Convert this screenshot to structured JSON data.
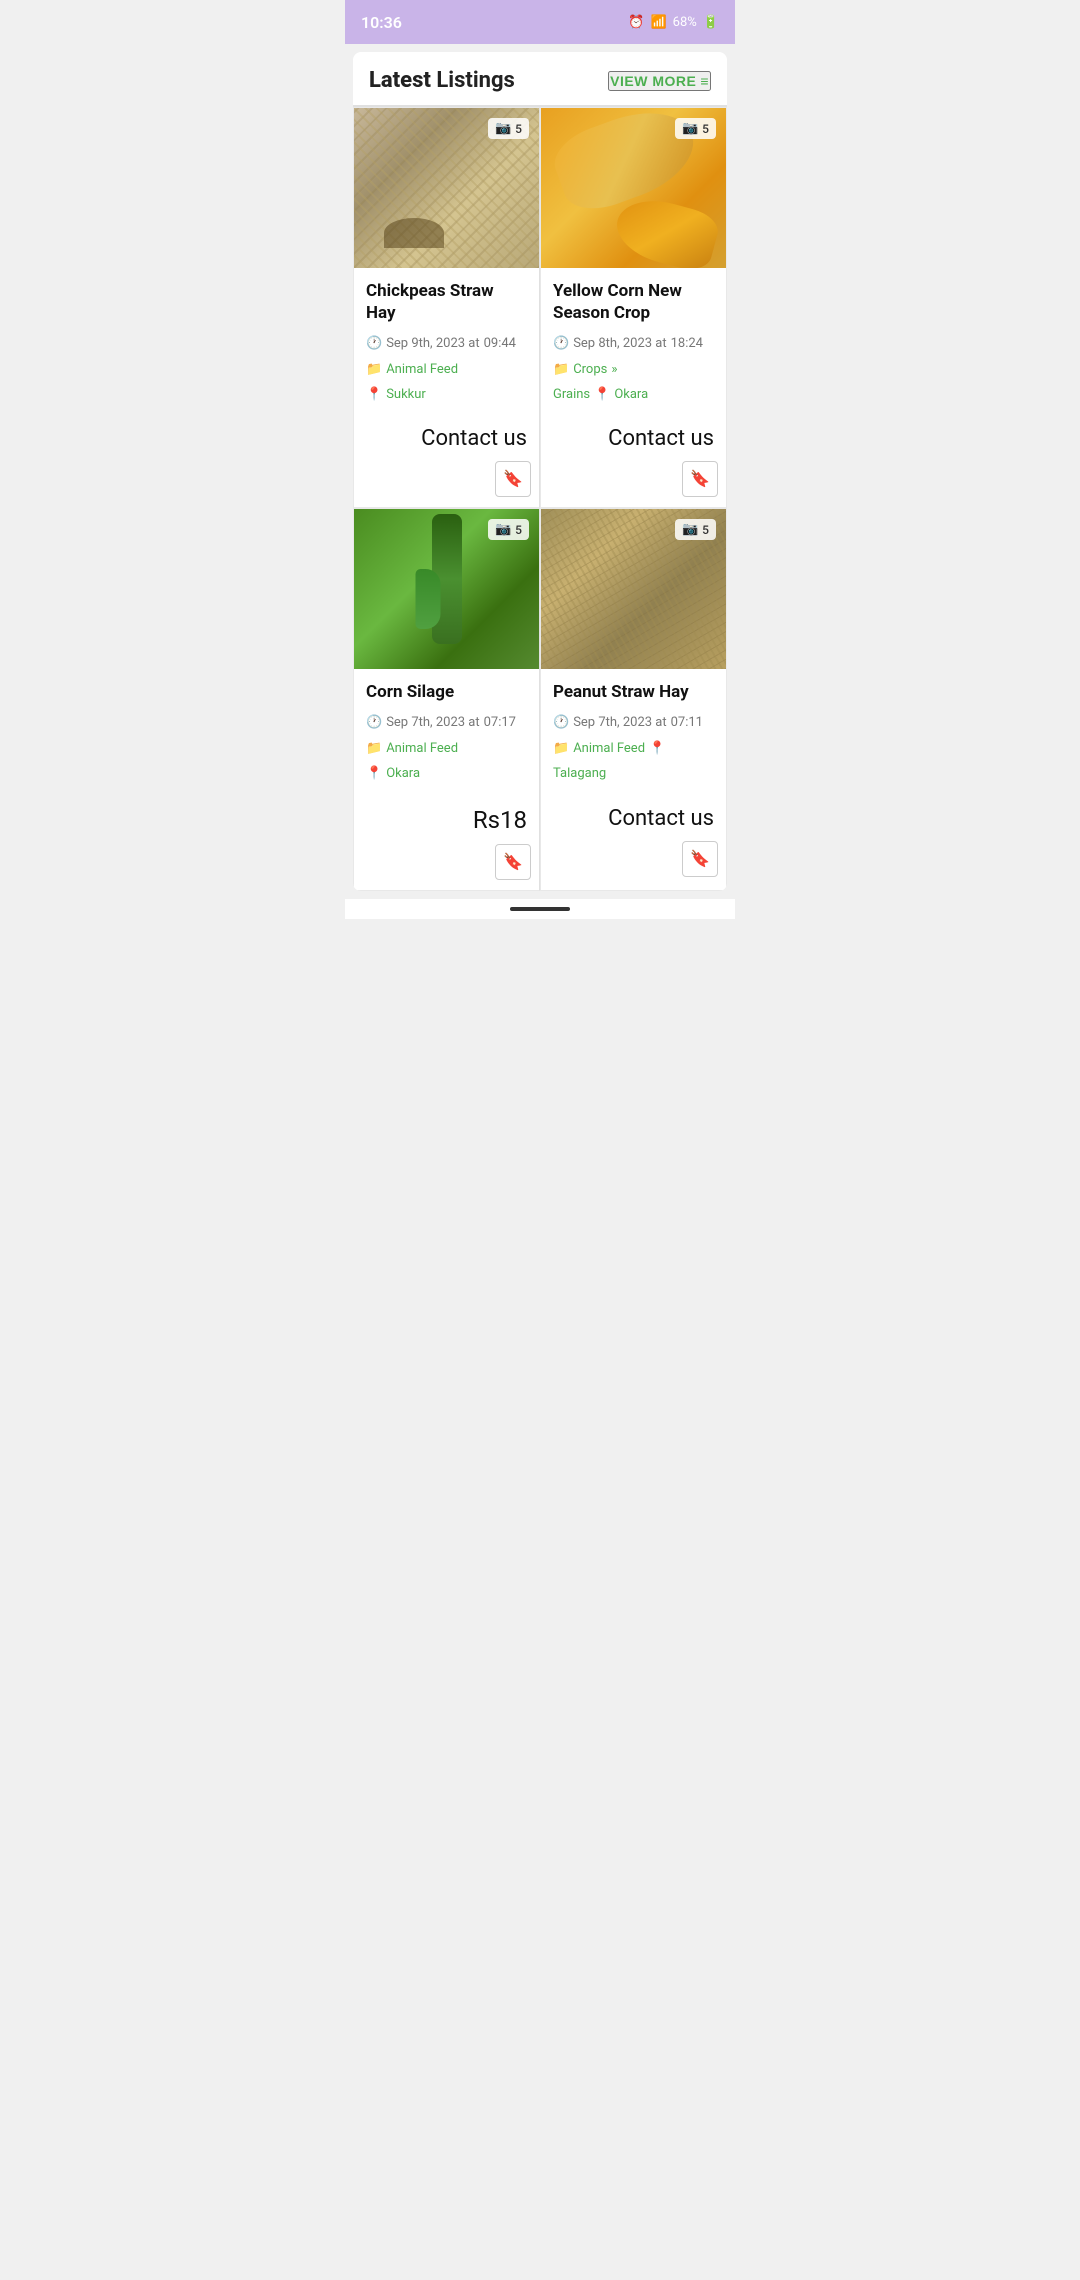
{
  "status_bar": {
    "time": "10:36",
    "battery": "68%"
  },
  "header": {
    "title_bold": "Latest",
    "title_light": " Listings",
    "view_more": "VIEW MORE"
  },
  "listings": [
    {
      "id": 1,
      "title": "Chickpeas Straw Hay",
      "date": "Sep 9th, 2023 at",
      "time": "09:44",
      "category": "Animal Feed",
      "location": "Sukkur",
      "subcategory": null,
      "photo_count": "5",
      "price": null,
      "contact": "Contact us",
      "img_type": "hay"
    },
    {
      "id": 2,
      "title": "Yellow Corn New Season Crop",
      "date": "Sep 8th, 2023 at",
      "time": "18:24",
      "category": "Crops",
      "subcategory": "Grains",
      "location": "Okara",
      "photo_count": "5",
      "price": null,
      "contact": "Contact us",
      "img_type": "corn"
    },
    {
      "id": 3,
      "title": "Corn Silage",
      "date": "Sep 7th, 2023 at",
      "time": "07:17",
      "category": "Animal Feed",
      "location": "Okara",
      "subcategory": null,
      "photo_count": "5",
      "price": "Rs18",
      "contact": null,
      "img_type": "corn-green"
    },
    {
      "id": 4,
      "title": "Peanut Straw Hay",
      "date": "Sep 7th, 2023 at",
      "time": "07:11",
      "category": "Animal Feed",
      "location": "Talagang",
      "subcategory": null,
      "photo_count": "5",
      "price": null,
      "contact": "Contact us",
      "img_type": "hay2"
    }
  ],
  "colors": {
    "green": "#4caf50",
    "status_bar_bg": "#c9b4e8"
  }
}
